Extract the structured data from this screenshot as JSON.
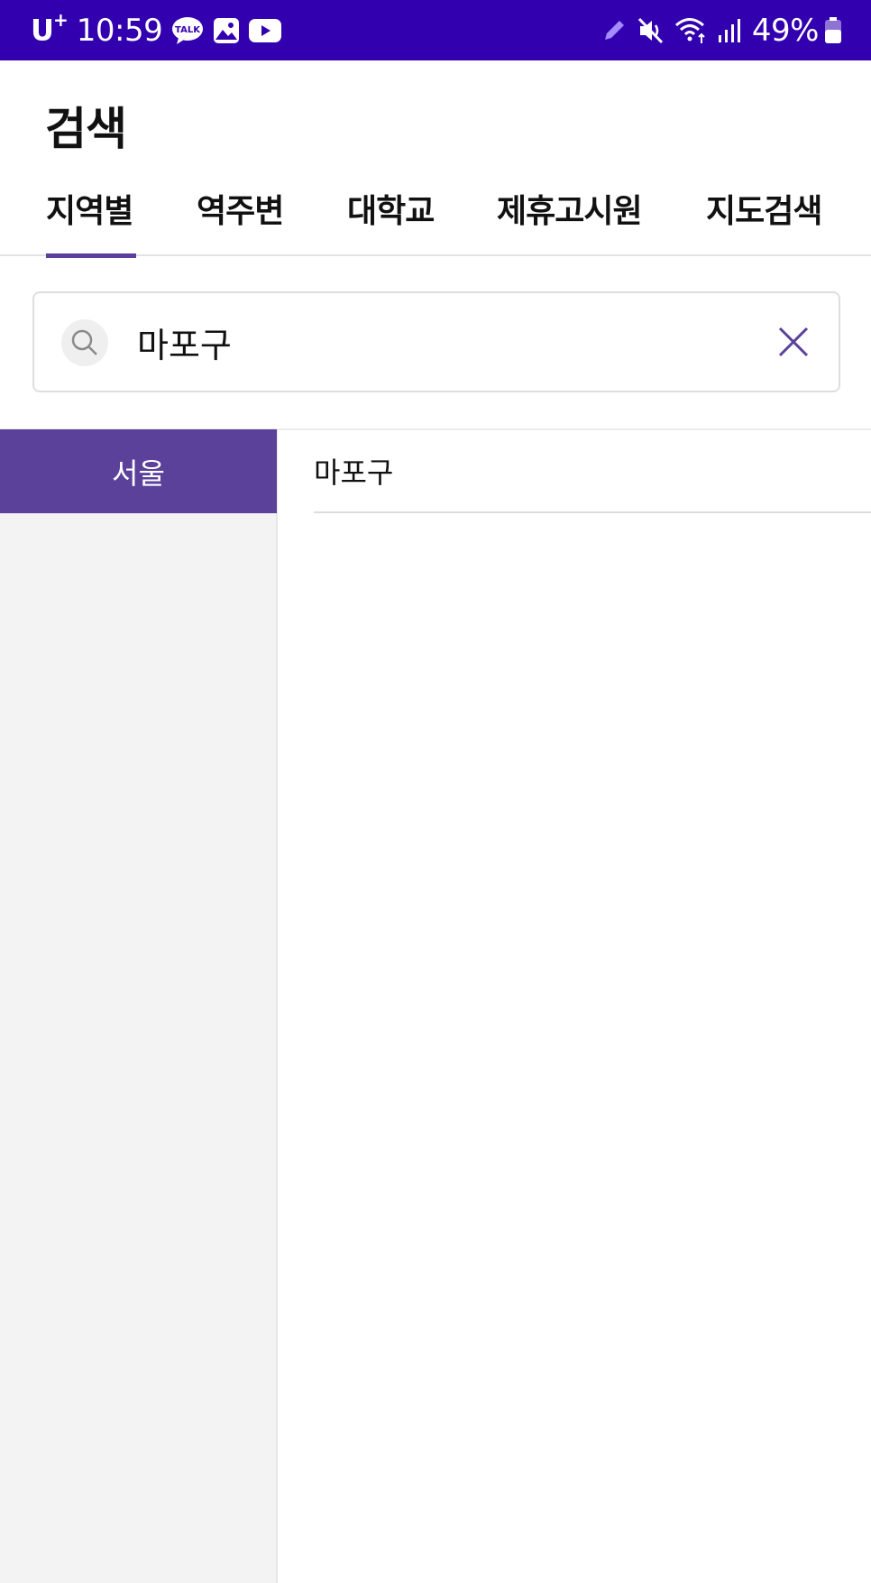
{
  "status_bar": {
    "carrier": "U",
    "carrier_sup": "+",
    "time": "10:59",
    "left_icons": [
      "kakaotalk-icon",
      "gallery-icon",
      "youtube-icon"
    ],
    "right_icons": [
      "pen-icon",
      "mute-icon",
      "wifi-icon",
      "signal-icon",
      "battery-icon"
    ],
    "battery": "49%",
    "background": "#3300b0"
  },
  "header": {
    "title": "검색"
  },
  "tabs": [
    {
      "label": "지역별",
      "active": true
    },
    {
      "label": "역주변",
      "active": false
    },
    {
      "label": "대학교",
      "active": false
    },
    {
      "label": "제휴고시원",
      "active": false
    },
    {
      "label": "지도검색",
      "active": false
    }
  ],
  "search": {
    "value": "마포구",
    "placeholder": ""
  },
  "regions": [
    {
      "label": "서울",
      "selected": true
    }
  ],
  "districts": [
    {
      "label": "마포구"
    }
  ],
  "colors": {
    "accent": "#5b419a",
    "status_bar": "#3300b0",
    "panel_bg": "#f3f3f3"
  }
}
